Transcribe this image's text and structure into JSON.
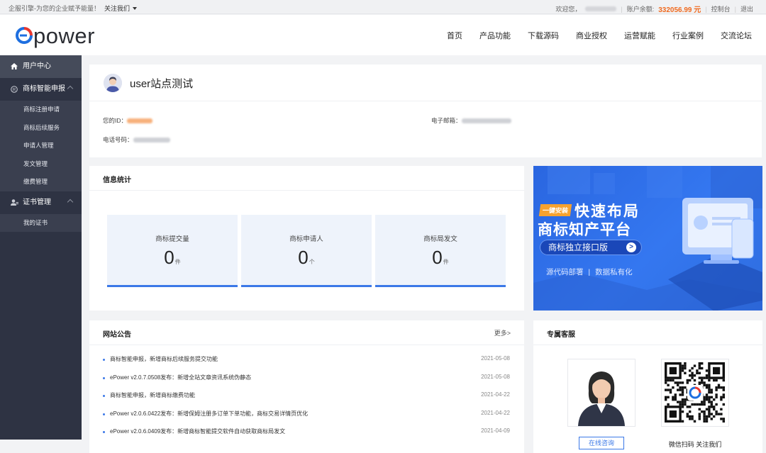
{
  "topbar": {
    "slogan": "企服引擎-为您的企业赋予能量！",
    "follow": "关注我们",
    "welcome": "欢迎您，",
    "balance_label": "账户余额:",
    "balance_value": "332056.99 元",
    "console": "控制台",
    "logout": "退出"
  },
  "logo": {
    "text": "power",
    "brand_color": "#1e6fe0",
    "accent_color": "#e8382f"
  },
  "nav": [
    "首页",
    "产品功能",
    "下载源码",
    "商业授权",
    "运营赋能",
    "行业案例",
    "交流论坛"
  ],
  "sidebar": {
    "user_center": "用户中心",
    "groups": [
      {
        "label": "商标智能申报",
        "icon": "registered-icon",
        "items": [
          "商标注册申请",
          "商标后续服务",
          "申请人管理",
          "发文管理",
          "缴费管理"
        ]
      },
      {
        "label": "证书管理",
        "icon": "user-cert-icon",
        "items": [
          "我的证书"
        ]
      }
    ]
  },
  "profile": {
    "name": "user站点测试",
    "id_label": "您的ID：",
    "email_label": "电子邮箱：",
    "phone_label": "电话号码："
  },
  "stats": {
    "title": "信息统计",
    "items": [
      {
        "label": "商标提交量",
        "value": "0",
        "unit": "件"
      },
      {
        "label": "商标申请人",
        "value": "0",
        "unit": "个"
      },
      {
        "label": "商标局发文",
        "value": "0",
        "unit": "件"
      }
    ]
  },
  "banner": {
    "tag": "一键安装",
    "line1": "快速布局",
    "line2": "商标知产平台",
    "pill": "商标独立接口版",
    "bottom_left": "源代码部署",
    "bottom_right": "数据私有化"
  },
  "notice": {
    "title": "网站公告",
    "more": "更多>",
    "items": [
      {
        "text": "商标智能申报，新增商标后续服务提交功能",
        "date": "2021-05-08"
      },
      {
        "text": "ePower v2.0.7.0508发布：新增全站文章资讯系统伪静态",
        "date": "2021-05-08"
      },
      {
        "text": "商标智能申报，新增商标缴费功能",
        "date": "2021-04-22"
      },
      {
        "text": "ePower v2.0.6.0422发布：新增保姆注册多订单下单功能，商标交易详情页优化",
        "date": "2021-04-22"
      },
      {
        "text": "ePower v2.0.6.0409发布：新增商标智能提交软件自动获取商标局发文",
        "date": "2021-04-09"
      }
    ]
  },
  "service": {
    "title": "专属客服",
    "consult": "在线咨询",
    "scan": "微信扫码 关注我们"
  }
}
